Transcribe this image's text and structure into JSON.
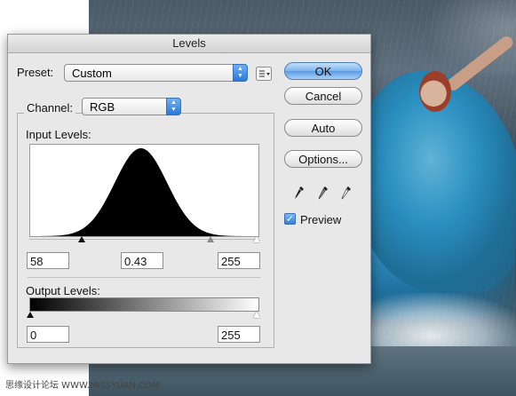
{
  "dialog": {
    "title": "Levels",
    "preset_label": "Preset:",
    "preset_value": "Custom",
    "channel_label": "Channel:",
    "channel_value": "RGB",
    "input_levels_label": "Input Levels:",
    "input_black": "58",
    "input_mid": "0.43",
    "input_white": "255",
    "output_levels_label": "Output Levels:",
    "output_black": "0",
    "output_white": "255",
    "buttons": {
      "ok": "OK",
      "cancel": "Cancel",
      "auto": "Auto",
      "options": "Options..."
    },
    "preview_label": "Preview",
    "preview_checked": true
  },
  "histogram": {
    "mean": 0.485,
    "spread": 0.115
  },
  "icons": [
    "list-icon",
    "black-point-eyedropper-icon",
    "gray-point-eyedropper-icon",
    "white-point-eyedropper-icon",
    "checkmark-icon",
    "chevron-updown-icon"
  ],
  "watermark": "思缘设计论坛  WWW.MISSYUAN.COM",
  "colors": {
    "default_button": "#5b9be5",
    "dress": "#2a8fc0"
  }
}
